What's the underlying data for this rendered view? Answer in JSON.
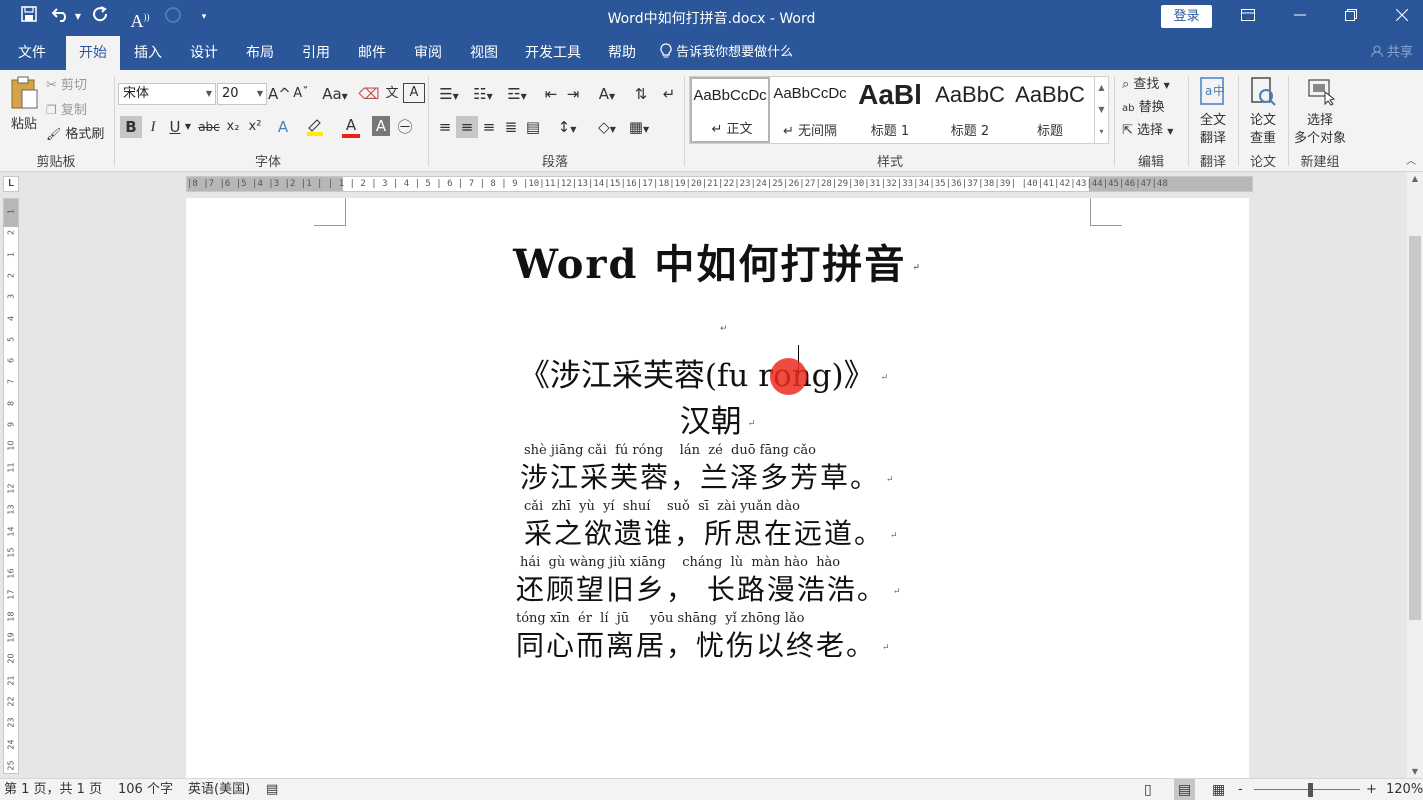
{
  "window": {
    "title": "Word中如何打拼音.docx  -  Word",
    "login_label": "登录"
  },
  "quick_access": {
    "save_icon": "save-icon",
    "undo_icon": "undo-icon",
    "redo_icon": "redo-icon",
    "font_icon_label": "A",
    "customize_icon": "chevron-down-icon"
  },
  "tabs": [
    {
      "label": "文件"
    },
    {
      "label": "开始"
    },
    {
      "label": "插入"
    },
    {
      "label": "设计"
    },
    {
      "label": "布局"
    },
    {
      "label": "引用"
    },
    {
      "label": "邮件"
    },
    {
      "label": "审阅"
    },
    {
      "label": "视图"
    },
    {
      "label": "开发工具"
    },
    {
      "label": "帮助"
    }
  ],
  "tellme": "告诉我你想要做什么",
  "share": "共享",
  "ribbon": {
    "clipboard": {
      "paste": "粘贴",
      "cut": "剪切",
      "copy": "复制",
      "format_painter": "格式刷",
      "group": "剪贴板"
    },
    "font": {
      "family": "宋体",
      "size": "20",
      "group": "字体",
      "bold": "B",
      "italic": "I",
      "underline": "U",
      "strike": "abc",
      "sub": "x₂",
      "sup": "x²",
      "grow": "A^",
      "shrink": "Aˇ",
      "case": "Aa",
      "font_color_letter": "A",
      "font_color": "#e8231a",
      "highlight_color": "#ffeb00"
    },
    "paragraph": {
      "group": "段落"
    },
    "styles": {
      "group": "样式",
      "items": [
        {
          "preview": "AaBbCcDc",
          "name": "↵ 正文"
        },
        {
          "preview": "AaBbCcDc",
          "name": "↵ 无间隔"
        },
        {
          "preview": "AaBl",
          "name": "标题 1"
        },
        {
          "preview": "AaBbC",
          "name": "标题 2"
        },
        {
          "preview": "AaBbC",
          "name": "标题"
        }
      ]
    },
    "editing": {
      "find": "查找",
      "replace": "替换",
      "select": "选择",
      "group": "编辑"
    },
    "translate": {
      "line1": "全文",
      "line2": "翻译",
      "group": "翻译"
    },
    "paper": {
      "line1": "论文",
      "line2": "查重",
      "group": "论文"
    },
    "newgroup": {
      "line1": "选择",
      "line2": "多个对象",
      "group": "新建组"
    }
  },
  "ruler": {
    "text": "|8 |7 |6 |5 |4 |3 |2 |1 |   | 1 | 2 | 3 | 4 | 5 | 6 | 7 | 8 | 9 |10|11|12|13|14|15|16|17|18|19|20|21|22|23|24|25|26|27|28|29|30|31|32|33|34|35|36|37|38|39|  |40|41|42|43|44|45|46|47|48",
    "vertical": [
      "1",
      "2",
      "1",
      "2",
      "3",
      "4",
      "5",
      "6",
      "7",
      "8",
      "9",
      "10",
      "11",
      "12",
      "13",
      "14",
      "15",
      "16",
      "17",
      "18",
      "19",
      "20",
      "21",
      "22",
      "23",
      "24",
      "25"
    ]
  },
  "document": {
    "title": "Word 中如何打拼音",
    "poem_title": "《涉江采芙蓉(fu rong)》",
    "dynasty": "汉朝",
    "lines": [
      {
        "pinyin": "shè jiāng cǎi  fú róng    lán  zé  duō fāng cǎo",
        "text": "涉江采芙蓉，兰泽多芳草。"
      },
      {
        "pinyin": "cǎi  zhī  yù  yí  shuí    suǒ  sī  zài yuǎn dào",
        "text": "采之欲遗谁，所思在远道。"
      },
      {
        "pinyin": "hái  gù wàng jiù xiāng    cháng  lù  màn hào  hào",
        "text": "还顾望旧乡， 长路漫浩浩。"
      },
      {
        "pinyin": "tóng xīn  ér  lí  jū     yōu shāng  yǐ zhōng lǎo",
        "text": "同心而离居，忧伤以终老。"
      }
    ]
  },
  "status": {
    "page": "第 1 页，共 1 页",
    "words": "106 个字",
    "language": "英语(美国)",
    "zoom": "120%",
    "zoom_minus": "-",
    "zoom_plus": "+"
  }
}
